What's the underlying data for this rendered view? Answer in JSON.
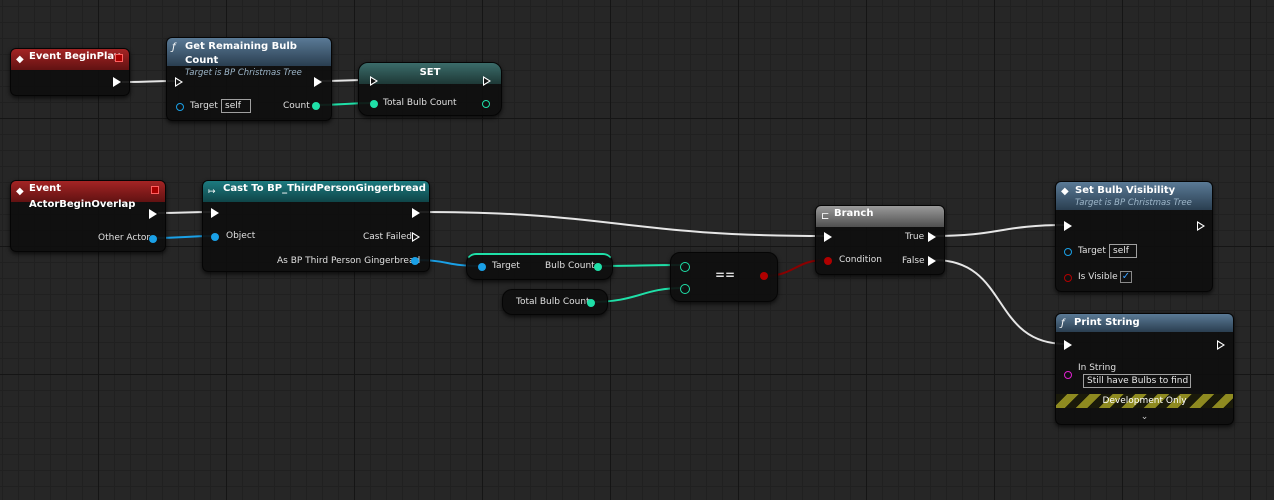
{
  "nodes": {
    "begin_play": {
      "title": "Event BeginPlay"
    },
    "get_remaining": {
      "title": "Get Remaining Bulb Count",
      "subtitle": "Target is BP Christmas Tree",
      "target_label": "Target",
      "target_value": "self",
      "out_label": "Count"
    },
    "set_node": {
      "title": "SET",
      "in_label": "Total Bulb Count"
    },
    "overlap": {
      "title": "Event ActorBeginOverlap",
      "other_actor_label": "Other Actor"
    },
    "cast": {
      "title": "Cast To BP_ThirdPersonGingerbread",
      "object_label": "Object",
      "failed_label": "Cast Failed",
      "as_label": "As BP Third Person Gingerbread"
    },
    "bulb_count": {
      "target_label": "Target",
      "out_label": "Bulb Count"
    },
    "total_var": {
      "label": "Total Bulb Count"
    },
    "equal": {
      "symbol": "=="
    },
    "branch": {
      "title": "Branch",
      "condition_label": "Condition",
      "true_label": "True",
      "false_label": "False"
    },
    "set_visibility": {
      "title": "Set Bulb Visibility",
      "subtitle": "Target is BP Christmas Tree",
      "target_label": "Target",
      "target_value": "self",
      "visible_label": "Is Visible",
      "visible_checked": true,
      "check_glyph": "✓"
    },
    "print_string": {
      "title": "Print String",
      "in_label": "In String",
      "in_value": "Still have Bulbs to find",
      "dev_label": "Development Only",
      "expand_glyph": "⌄"
    }
  },
  "icons": {
    "event": "event-diamond-icon",
    "function": "function-f-icon",
    "cast": "cast-arrows-icon",
    "branch": "branch-split-icon"
  },
  "colors": {
    "exec_wire": "#e6e6e6",
    "object_pin": "#1aa0e6",
    "int_pin": "#1fe0a8",
    "bool_pin": "#b00000",
    "string_pin": "#e020d0",
    "event_header": "#a42424",
    "function_header": "#5a7a96"
  }
}
